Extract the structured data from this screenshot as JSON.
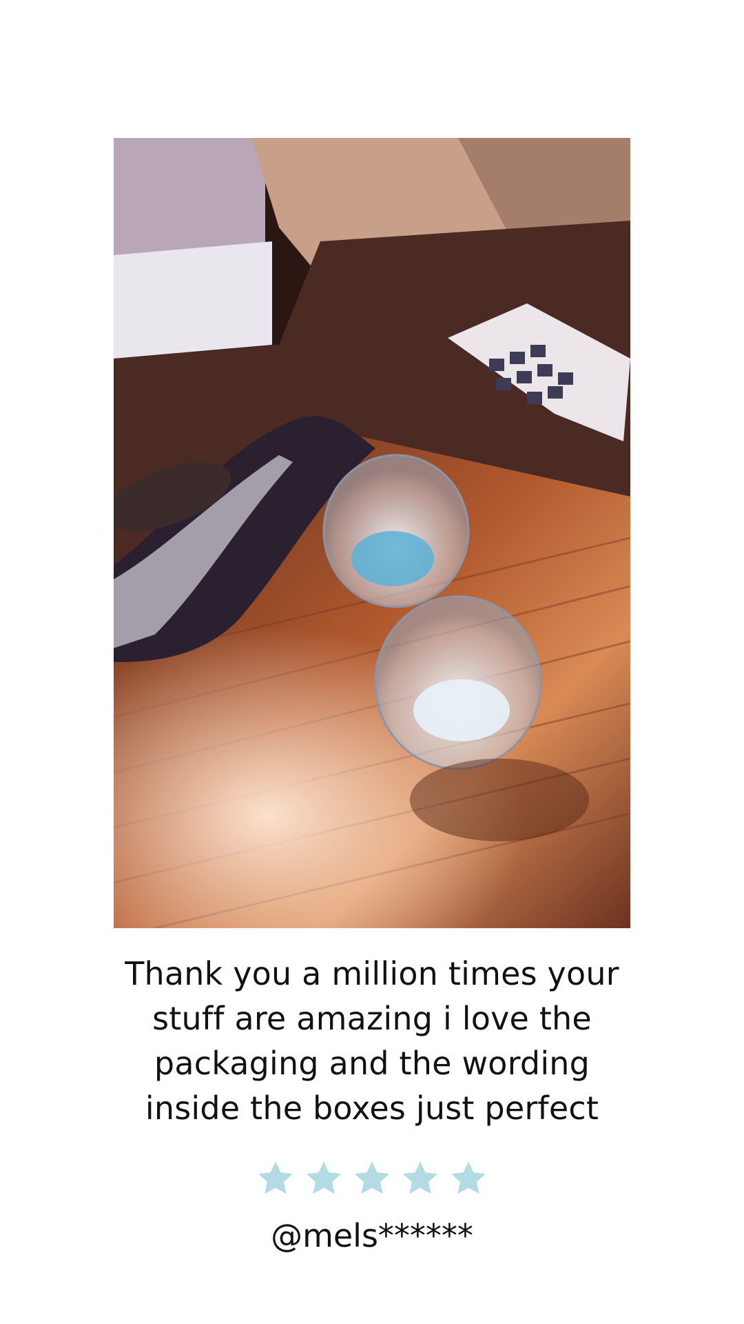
{
  "review": {
    "text": "Thank you a million times your stuff are amazing i love the packaging and the wording inside the boxes just perfect",
    "rating": 5,
    "max_rating": 5,
    "handle": "@mels******"
  },
  "colors": {
    "star": "#b3dbe3",
    "background": "#ffffff",
    "text": "#111111"
  },
  "icons": {
    "rating": "star-icon"
  }
}
